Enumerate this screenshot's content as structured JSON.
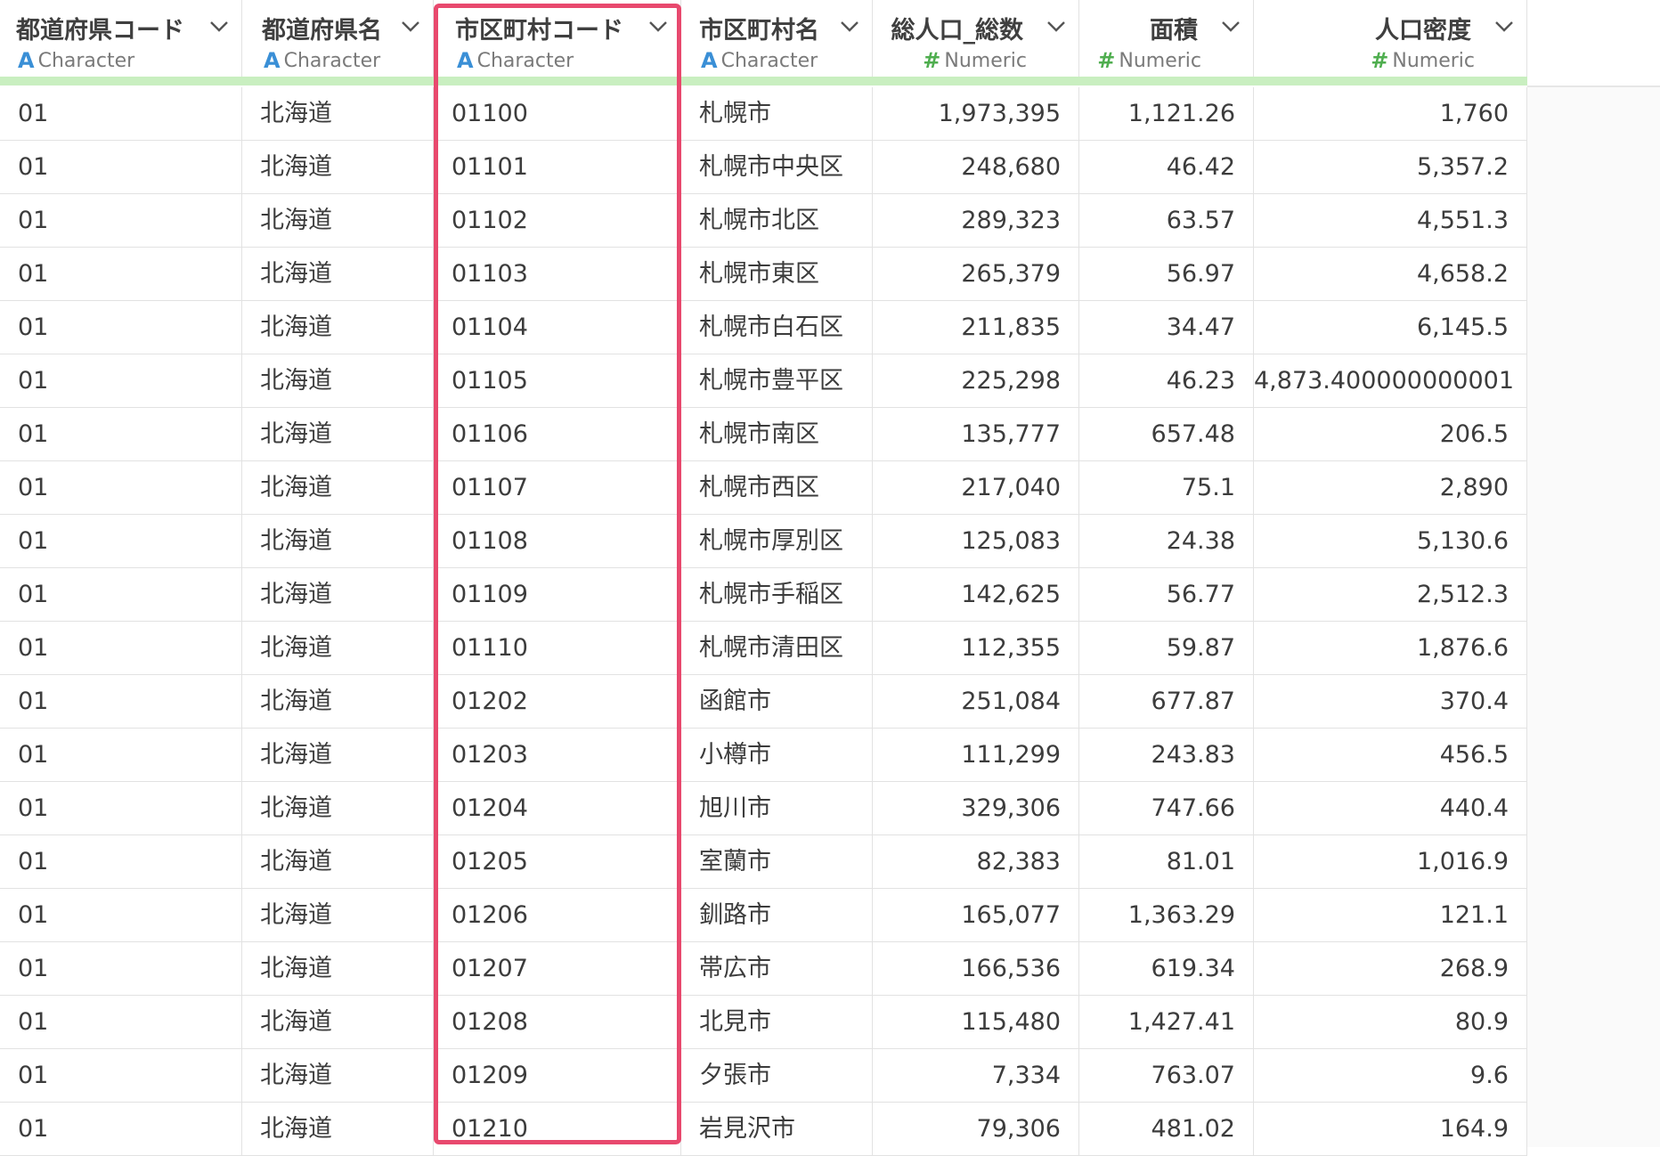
{
  "columns": [
    {
      "name": "都道府県コード",
      "type_icon": "A",
      "type_label": "Character",
      "align": "left"
    },
    {
      "name": "都道府県名",
      "type_icon": "A",
      "type_label": "Character",
      "align": "left"
    },
    {
      "name": "市区町村コード",
      "type_icon": "A",
      "type_label": "Character",
      "align": "left"
    },
    {
      "name": "市区町村名",
      "type_icon": "A",
      "type_label": "Character",
      "align": "left"
    },
    {
      "name": "総人口_総数",
      "type_icon": "#",
      "type_label": "Numeric",
      "align": "right"
    },
    {
      "name": "面積",
      "type_icon": "#",
      "type_label": "Numeric",
      "align": "right"
    },
    {
      "name": "人口密度",
      "type_icon": "#",
      "type_label": "Numeric",
      "align": "right"
    }
  ],
  "rows": [
    [
      "01",
      "北海道",
      "01100",
      "札幌市",
      "1,973,395",
      "1,121.26",
      "1,760"
    ],
    [
      "01",
      "北海道",
      "01101",
      "札幌市中央区",
      "248,680",
      "46.42",
      "5,357.2"
    ],
    [
      "01",
      "北海道",
      "01102",
      "札幌市北区",
      "289,323",
      "63.57",
      "4,551.3"
    ],
    [
      "01",
      "北海道",
      "01103",
      "札幌市東区",
      "265,379",
      "56.97",
      "4,658.2"
    ],
    [
      "01",
      "北海道",
      "01104",
      "札幌市白石区",
      "211,835",
      "34.47",
      "6,145.5"
    ],
    [
      "01",
      "北海道",
      "01105",
      "札幌市豊平区",
      "225,298",
      "46.23",
      "4,873.400000000001"
    ],
    [
      "01",
      "北海道",
      "01106",
      "札幌市南区",
      "135,777",
      "657.48",
      "206.5"
    ],
    [
      "01",
      "北海道",
      "01107",
      "札幌市西区",
      "217,040",
      "75.1",
      "2,890"
    ],
    [
      "01",
      "北海道",
      "01108",
      "札幌市厚別区",
      "125,083",
      "24.38",
      "5,130.6"
    ],
    [
      "01",
      "北海道",
      "01109",
      "札幌市手稲区",
      "142,625",
      "56.77",
      "2,512.3"
    ],
    [
      "01",
      "北海道",
      "01110",
      "札幌市清田区",
      "112,355",
      "59.87",
      "1,876.6"
    ],
    [
      "01",
      "北海道",
      "01202",
      "函館市",
      "251,084",
      "677.87",
      "370.4"
    ],
    [
      "01",
      "北海道",
      "01203",
      "小樽市",
      "111,299",
      "243.83",
      "456.5"
    ],
    [
      "01",
      "北海道",
      "01204",
      "旭川市",
      "329,306",
      "747.66",
      "440.4"
    ],
    [
      "01",
      "北海道",
      "01205",
      "室蘭市",
      "82,383",
      "81.01",
      "1,016.9"
    ],
    [
      "01",
      "北海道",
      "01206",
      "釧路市",
      "165,077",
      "1,363.29",
      "121.1"
    ],
    [
      "01",
      "北海道",
      "01207",
      "帯広市",
      "166,536",
      "619.34",
      "268.9"
    ],
    [
      "01",
      "北海道",
      "01208",
      "北見市",
      "115,480",
      "1,427.41",
      "80.9"
    ],
    [
      "01",
      "北海道",
      "01209",
      "夕張市",
      "7,334",
      "763.07",
      "9.6"
    ],
    [
      "01",
      "北海道",
      "01210",
      "岩見沢市",
      "79,306",
      "481.02",
      "164.9"
    ]
  ],
  "highlighted_column": "市区町村コード",
  "colors": {
    "highlight": "#e8496e",
    "header_bar": "#c9efc0",
    "character_icon": "#3a8fd6",
    "numeric_icon": "#4fae4f"
  }
}
